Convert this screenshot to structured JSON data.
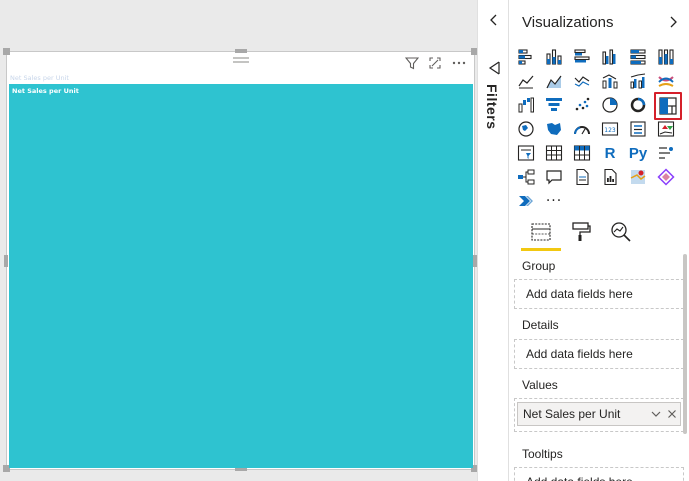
{
  "visual": {
    "title": "Net Sales per Unit",
    "tile_label": "Net Sales per Unit",
    "fill_color": "#2ec3d0"
  },
  "filters": {
    "label": "Filters"
  },
  "visualizations": {
    "title": "Visualizations",
    "more_label": "···",
    "selected": "treemap-icon"
  },
  "wells": {
    "group_label": "Group",
    "group_placeholder": "Add data fields here",
    "details_label": "Details",
    "details_placeholder": "Add data fields here",
    "values_label": "Values",
    "values_field": "Net Sales per Unit",
    "tooltips_label": "Tooltips",
    "tooltips_placeholder": "Add data fields here"
  },
  "colors": {
    "accent": "#f2c811",
    "icon_blue": "#0f6cbd",
    "selection_red": "#d5202a"
  }
}
